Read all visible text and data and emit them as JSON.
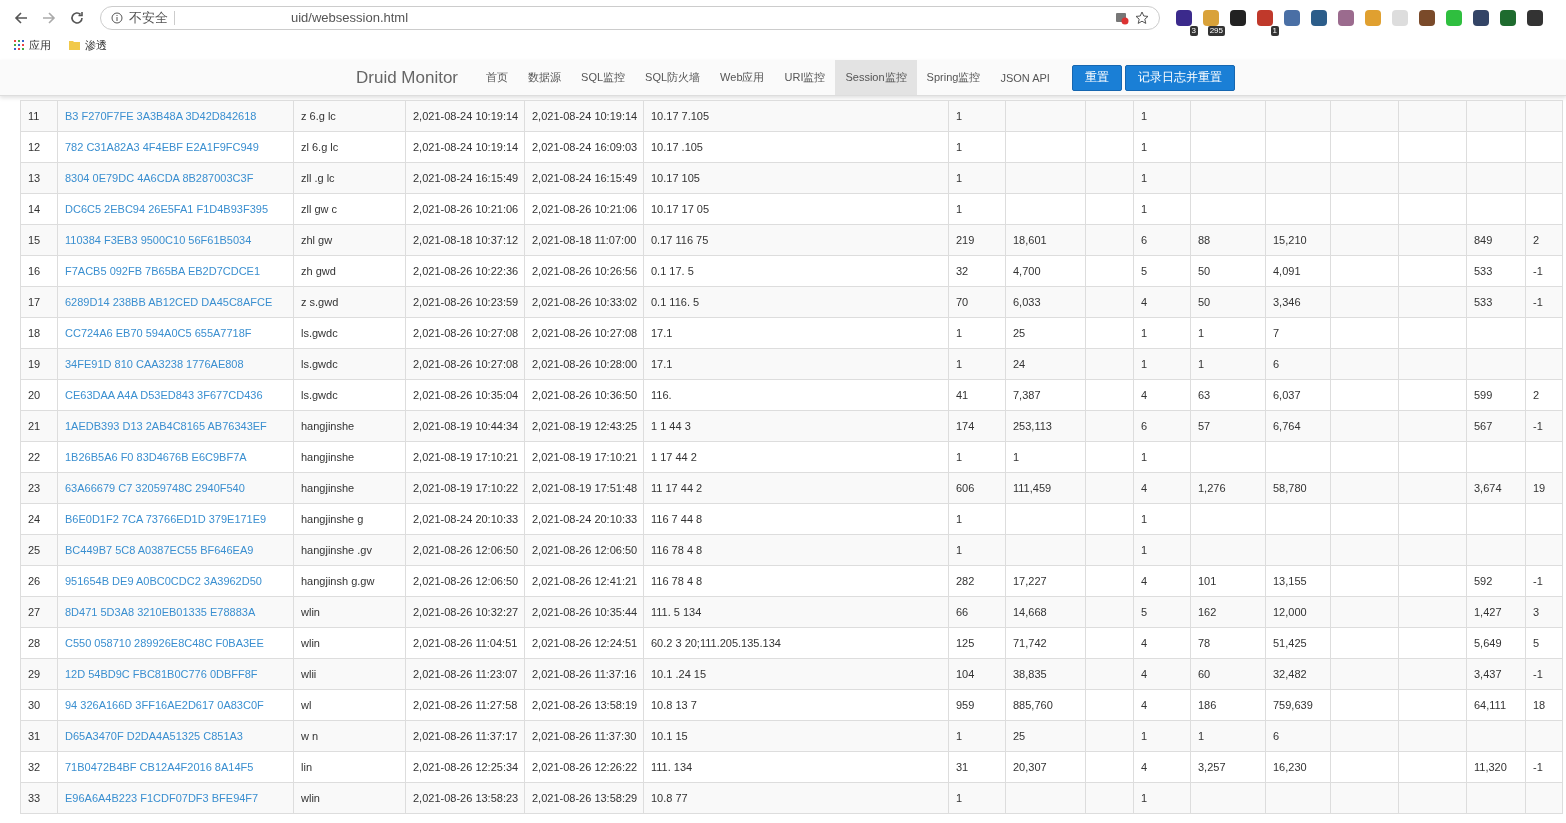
{
  "browser": {
    "security_label": "不安全",
    "url": "uid/websession.html",
    "extensions": [
      {
        "color": "#3b2a8c",
        "badge": "3"
      },
      {
        "color": "#d9a23a",
        "badge": "295"
      },
      {
        "color": "#222222"
      },
      {
        "color": "#c0392b",
        "badge": "1"
      },
      {
        "color": "#4a6fa5"
      },
      {
        "color": "#2c5d8a"
      },
      {
        "color": "#9b6b8e"
      },
      {
        "color": "#e0a030"
      },
      {
        "color": "#dddddd"
      },
      {
        "color": "#7a4a2a"
      },
      {
        "color": "#2fbf3f"
      },
      {
        "color": "#334466"
      },
      {
        "color": "#1e6b2e"
      },
      {
        "color": "#333333"
      }
    ],
    "bookmarks": [
      {
        "label": "应用",
        "kind": "apps"
      },
      {
        "label": "渗透",
        "kind": "folder"
      }
    ]
  },
  "navbar": {
    "brand": "Druid Monitor",
    "items": [
      {
        "label": "首页",
        "selected": false
      },
      {
        "label": "数据源",
        "selected": false
      },
      {
        "label": "SQL监控",
        "selected": false
      },
      {
        "label": "SQL防火墙",
        "selected": false
      },
      {
        "label": "Web应用",
        "selected": false
      },
      {
        "label": "URI监控",
        "selected": false
      },
      {
        "label": "Session监控",
        "selected": true
      },
      {
        "label": "Spring监控",
        "selected": false
      },
      {
        "label": "JSON API",
        "selected": false
      }
    ],
    "buttons": [
      "重置",
      "记录日志并重置"
    ]
  },
  "table": {
    "rows": [
      {
        "cells": [
          "11",
          "B3 F270F7FE 3A3B48A 3D42D842618",
          "z 6.g lc",
          "2,021-08-24 10:19:14",
          "2,021-08-24 10:19:14",
          "10.17 7.105",
          "1",
          null,
          null,
          "1",
          null,
          null,
          null,
          null,
          null,
          null
        ]
      },
      {
        "cells": [
          "12",
          "782 C31A82A3 4F4EBF E2A1F9FC949",
          "zl 6.g lc",
          "2,021-08-24 10:19:14",
          "2,021-08-24 16:09:03",
          "10.17 .105",
          "1",
          null,
          null,
          "1",
          null,
          null,
          null,
          null,
          null,
          null
        ]
      },
      {
        "cells": [
          "13",
          "8304 0E79DC 4A6CDA 8B287003C3F",
          "zll .g lc",
          "2,021-08-24 16:15:49",
          "2,021-08-24 16:15:49",
          "10.17 105",
          "1",
          null,
          null,
          "1",
          null,
          null,
          null,
          null,
          null,
          null
        ]
      },
      {
        "cells": [
          "14",
          "DC6C5 2EBC94 26E5FA1 F1D4B93F395",
          "zll gw c",
          "2,021-08-26 10:21:06",
          "2,021-08-26 10:21:06",
          "10.17 17 05",
          "1",
          null,
          null,
          "1",
          null,
          null,
          null,
          null,
          null,
          null
        ]
      },
      {
        "cells": [
          "15",
          "110384 F3EB3 9500C10 56F61B5034",
          "zhl gw",
          "2,021-08-18 10:37:12",
          "2,021-08-18 11:07:00",
          "0.17 116 75",
          "219",
          "18,601",
          null,
          "6",
          "88",
          "15,210",
          null,
          null,
          "849",
          "2"
        ]
      },
      {
        "cells": [
          "16",
          "F7ACB5 092FB 7B65BA EB2D7CDCE1",
          "zh gwd",
          "2,021-08-26 10:22:36",
          "2,021-08-26 10:26:56",
          "0.1 17. 5",
          "32",
          "4,700",
          null,
          "5",
          "50",
          "4,091",
          null,
          null,
          "533",
          "-1"
        ]
      },
      {
        "cells": [
          "17",
          "6289D14 238BB AB12CED DA45C8AFCE",
          "z s.gwd",
          "2,021-08-26 10:23:59",
          "2,021-08-26 10:33:02",
          "0.1 116. 5",
          "70",
          "6,033",
          null,
          "4",
          "50",
          "3,346",
          null,
          null,
          "533",
          "-1"
        ]
      },
      {
        "cells": [
          "18",
          "CC724A6 EB70 594A0C5 655A7718F",
          "ls.gwdc",
          "2,021-08-26 10:27:08",
          "2,021-08-26 10:27:08",
          "17.1",
          "1",
          "25",
          null,
          "1",
          "1",
          "7",
          null,
          null,
          null,
          null
        ]
      },
      {
        "cells": [
          "19",
          "34FE91D 810 CAA3238 1776AE808",
          "ls.gwdc",
          "2,021-08-26 10:27:08",
          "2,021-08-26 10:28:00",
          "17.1",
          "1",
          "24",
          null,
          "1",
          "1",
          "6",
          null,
          null,
          null,
          null
        ]
      },
      {
        "cells": [
          "20",
          "CE63DAA A4A D53ED843 3F677CD436",
          "ls.gwdc",
          "2,021-08-26 10:35:04",
          "2,021-08-26 10:36:50",
          "116.",
          "41",
          "7,387",
          null,
          "4",
          "63",
          "6,037",
          null,
          null,
          "599",
          "2"
        ]
      },
      {
        "cells": [
          "21",
          "1AEDB393 D13 2AB4C8165 AB76343EF",
          "hangjinshe",
          "2,021-08-19 10:44:34",
          "2,021-08-19 12:43:25",
          "1 1 44 3",
          "174",
          "253,113",
          null,
          "6",
          "57",
          "6,764",
          null,
          null,
          "567",
          "-1"
        ]
      },
      {
        "cells": [
          "22",
          "1B26B5A6 F0 83D4676B E6C9BF7A",
          "hangjinshe",
          "2,021-08-19 17:10:21",
          "2,021-08-19 17:10:21",
          "1 17 44 2",
          "1",
          "1",
          null,
          "1",
          null,
          null,
          null,
          null,
          null,
          null
        ]
      },
      {
        "cells": [
          "23",
          "63A66679 C7 32059748C 2940F540",
          "hangjinshe",
          "2,021-08-19 17:10:22",
          "2,021-08-19 17:51:48",
          "11 17 44 2",
          "606",
          "111,459",
          null,
          "4",
          "1,276",
          "58,780",
          null,
          null,
          "3,674",
          "19"
        ]
      },
      {
        "cells": [
          "24",
          "B6E0D1F2 7CA 73766ED1D 379E171E9",
          "hangjinshe g",
          "2,021-08-24 20:10:33",
          "2,021-08-24 20:10:33",
          "116 7 44 8",
          "1",
          null,
          null,
          "1",
          null,
          null,
          null,
          null,
          null,
          null
        ]
      },
      {
        "cells": [
          "25",
          "BC449B7 5C8 A0387EC55 BF646EA9",
          "hangjinshe .gv",
          "2,021-08-26 12:06:50",
          "2,021-08-26 12:06:50",
          "116 78 4 8",
          "1",
          null,
          null,
          "1",
          null,
          null,
          null,
          null,
          null,
          null
        ]
      },
      {
        "cells": [
          "26",
          "951654B DE9 A0BC0CDC2 3A3962D50",
          "hangjinsh g.gw",
          "2,021-08-26 12:06:50",
          "2,021-08-26 12:41:21",
          "116 78 4 8",
          "282",
          "17,227",
          null,
          "4",
          "101",
          "13,155",
          null,
          null,
          "592",
          "-1"
        ]
      },
      {
        "cells": [
          "27",
          "8D471 5D3A8 3210EB01335 E78883A",
          "wlin",
          "2,021-08-26 10:32:27",
          "2,021-08-26 10:35:44",
          "111. 5 134",
          "66",
          "14,668",
          null,
          "5",
          "162",
          "12,000",
          null,
          null,
          "1,427",
          "3"
        ]
      },
      {
        "cells": [
          "28",
          "C550 058710 289926E8C48C F0BA3EE",
          "wlin",
          "2,021-08-26 11:04:51",
          "2,021-08-26 12:24:51",
          "60.2 3 20;111.205.135.134",
          "125",
          "71,742",
          null,
          "4",
          "78",
          "51,425",
          null,
          null,
          "5,649",
          "5"
        ]
      },
      {
        "cells": [
          "29",
          "12D 54BD9C FBC81B0C776 0DBFF8F",
          "wlii",
          "2,021-08-26 11:23:07",
          "2,021-08-26 11:37:16",
          "10.1 .24 15",
          "104",
          "38,835",
          null,
          "4",
          "60",
          "32,482",
          null,
          null,
          "3,437",
          "-1"
        ]
      },
      {
        "cells": [
          "30",
          "94 326A166D 3FF16AE2D617 0A83C0F",
          "wl",
          "2,021-08-26 11:27:58",
          "2,021-08-26 13:58:19",
          "10.8 13 7",
          "959",
          "885,760",
          null,
          "4",
          "186",
          "759,639",
          null,
          null,
          "64,111",
          "18"
        ]
      },
      {
        "cells": [
          "31",
          "D65A3470F D2DA4A51325 C851A3",
          "w n",
          "2,021-08-26 11:37:17",
          "2,021-08-26 11:37:30",
          "10.1 15",
          "1",
          "25",
          null,
          "1",
          "1",
          "6",
          null,
          null,
          null,
          null
        ]
      },
      {
        "cells": [
          "32",
          "71B0472B4BF CB12A4F2016 8A14F5",
          "lin",
          "2,021-08-26 12:25:34",
          "2,021-08-26 12:26:22",
          "111. 134",
          "31",
          "20,307",
          null,
          "4",
          "3,257",
          "16,230",
          null,
          null,
          "11,320",
          "-1"
        ]
      },
      {
        "cells": [
          "33",
          "E96A6A4B223 F1CDF07DF3 BFE94F7",
          "wlin",
          "2,021-08-26 13:58:23",
          "2,021-08-26 13:58:29",
          "10.8 77",
          "1",
          null,
          null,
          "1",
          null,
          null,
          null,
          null,
          null,
          null
        ]
      }
    ]
  }
}
